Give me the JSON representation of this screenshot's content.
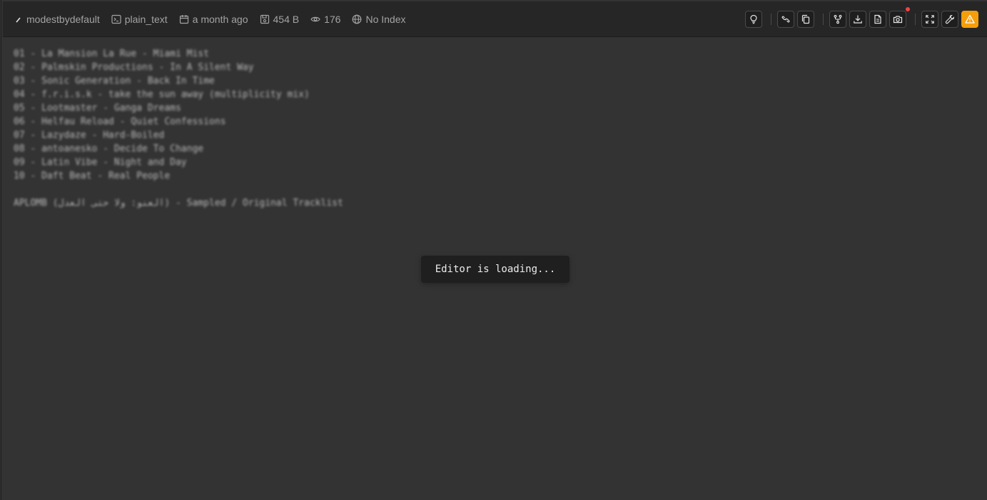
{
  "header": {
    "author": "modestbydefault",
    "language": "plain_text",
    "date": "a month ago",
    "size": "454 B",
    "views": "176",
    "index_status": "No Index"
  },
  "toolbar": {
    "buttons": [
      "lightbulb-icon",
      "link-icon",
      "copy-icon",
      "fork-icon",
      "download-icon",
      "file-icon",
      "camera-icon",
      "fullscreen-icon",
      "wrench-icon",
      "warning-icon"
    ],
    "warning_color": "#f59e0b",
    "notification_color": "#ef4444"
  },
  "editor": {
    "lines": [
      "01 - La Mansion La Rue - Miami Mist",
      "02 - Palmskin Productions - In A Silent Way",
      "03 - Sonic Generation - Back In Time",
      "04 - f.r.i.s.k - take the sun away (multiplicity mix)",
      "05 - Lootmaster - Ganga Dreams",
      "06 - Helfau Reload - Quiet Confessions",
      "07 - Lazydaze - Hard-Boiled",
      "08 - antoanesko - Decide To Change",
      "09 - Latin Vibe - Night and Day",
      "10 - Daft Beat - Real People",
      "",
      "APLOMB (العنو: ولا حتى العدل) - Sampled / Original Tracklist"
    ]
  },
  "toast": {
    "message": "Editor is loading..."
  }
}
